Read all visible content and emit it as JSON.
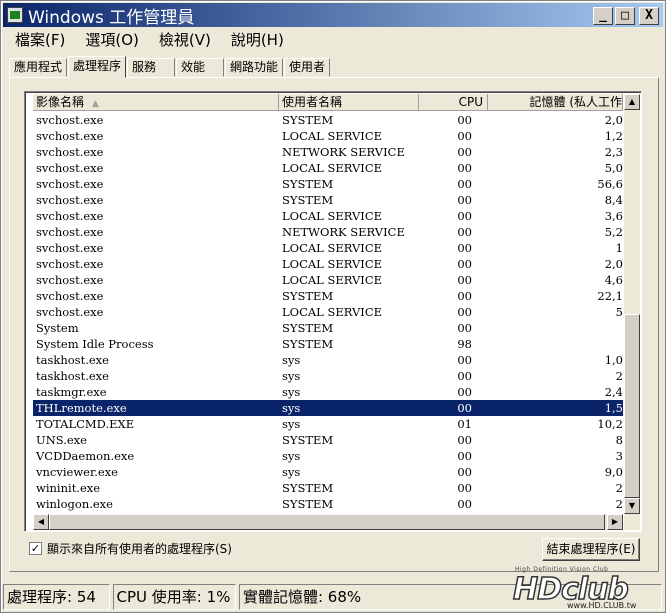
{
  "window": {
    "title": "Windows 工作管理員"
  },
  "window_buttons": {
    "minimize": "_",
    "maximize": "□",
    "close": "X"
  },
  "menu": [
    "檔案(F)",
    "選項(O)",
    "檢視(V)",
    "說明(H)"
  ],
  "tabs": [
    "應用程式",
    "處理程序",
    "服務",
    "效能",
    "網路功能",
    "使用者"
  ],
  "active_tab": 1,
  "columns": {
    "image": "影像名稱",
    "user": "使用者名稱",
    "cpu": "CPU",
    "memory": "記憶體 (私人工作"
  },
  "rows": [
    {
      "image": "svchost.exe",
      "user": "SYSTEM",
      "cpu": "00",
      "mem": "2,0"
    },
    {
      "image": "svchost.exe",
      "user": "LOCAL SERVICE",
      "cpu": "00",
      "mem": "1,2"
    },
    {
      "image": "svchost.exe",
      "user": "NETWORK SERVICE",
      "cpu": "00",
      "mem": "2,3"
    },
    {
      "image": "svchost.exe",
      "user": "LOCAL SERVICE",
      "cpu": "00",
      "mem": "5,0"
    },
    {
      "image": "svchost.exe",
      "user": "SYSTEM",
      "cpu": "00",
      "mem": "56,6"
    },
    {
      "image": "svchost.exe",
      "user": "SYSTEM",
      "cpu": "00",
      "mem": "8,4"
    },
    {
      "image": "svchost.exe",
      "user": "LOCAL SERVICE",
      "cpu": "00",
      "mem": "3,6"
    },
    {
      "image": "svchost.exe",
      "user": "NETWORK SERVICE",
      "cpu": "00",
      "mem": "5,2"
    },
    {
      "image": "svchost.exe",
      "user": "LOCAL SERVICE",
      "cpu": "00",
      "mem": "1"
    },
    {
      "image": "svchost.exe",
      "user": "LOCAL SERVICE",
      "cpu": "00",
      "mem": "2,0"
    },
    {
      "image": "svchost.exe",
      "user": "LOCAL SERVICE",
      "cpu": "00",
      "mem": "4,6"
    },
    {
      "image": "svchost.exe",
      "user": "SYSTEM",
      "cpu": "00",
      "mem": "22,1"
    },
    {
      "image": "svchost.exe",
      "user": "LOCAL SERVICE",
      "cpu": "00",
      "mem": "5"
    },
    {
      "image": "System",
      "user": "SYSTEM",
      "cpu": "00",
      "mem": ""
    },
    {
      "image": "System Idle Process",
      "user": "SYSTEM",
      "cpu": "98",
      "mem": ""
    },
    {
      "image": "taskhost.exe",
      "user": "sys",
      "cpu": "00",
      "mem": "1,0"
    },
    {
      "image": "taskhost.exe",
      "user": "sys",
      "cpu": "00",
      "mem": "2"
    },
    {
      "image": "taskmgr.exe",
      "user": "sys",
      "cpu": "00",
      "mem": "2,4"
    },
    {
      "image": "THLremote.exe",
      "user": "sys",
      "cpu": "00",
      "mem": "1,5",
      "selected": true
    },
    {
      "image": "TOTALCMD.EXE",
      "user": "sys",
      "cpu": "01",
      "mem": "10,2"
    },
    {
      "image": "UNS.exe",
      "user": "SYSTEM",
      "cpu": "00",
      "mem": "8"
    },
    {
      "image": "VCDDaemon.exe",
      "user": "sys",
      "cpu": "00",
      "mem": "3"
    },
    {
      "image": "vncviewer.exe",
      "user": "sys",
      "cpu": "00",
      "mem": "9,0"
    },
    {
      "image": "wininit.exe",
      "user": "SYSTEM",
      "cpu": "00",
      "mem": "2"
    },
    {
      "image": "winlogon.exe",
      "user": "SYSTEM",
      "cpu": "00",
      "mem": "2"
    }
  ],
  "show_all": {
    "label": "顯示來自所有使用者的處理程序(S)",
    "checked": true,
    "mark": "✓"
  },
  "end_process_button": "結束處理程序(E)",
  "status": {
    "processes": "處理程序: 54",
    "cpu": "CPU 使用率: 1%",
    "memory": "實體記憶體: 68%"
  },
  "watermark": {
    "tagline": "High Definition Vision Club",
    "logo": "HDclub",
    "url": "www.HD.CLUB.tw"
  },
  "colors": {
    "selection": "#0a246a",
    "titlebar": "#0a246a",
    "face": "#ece9d8"
  }
}
